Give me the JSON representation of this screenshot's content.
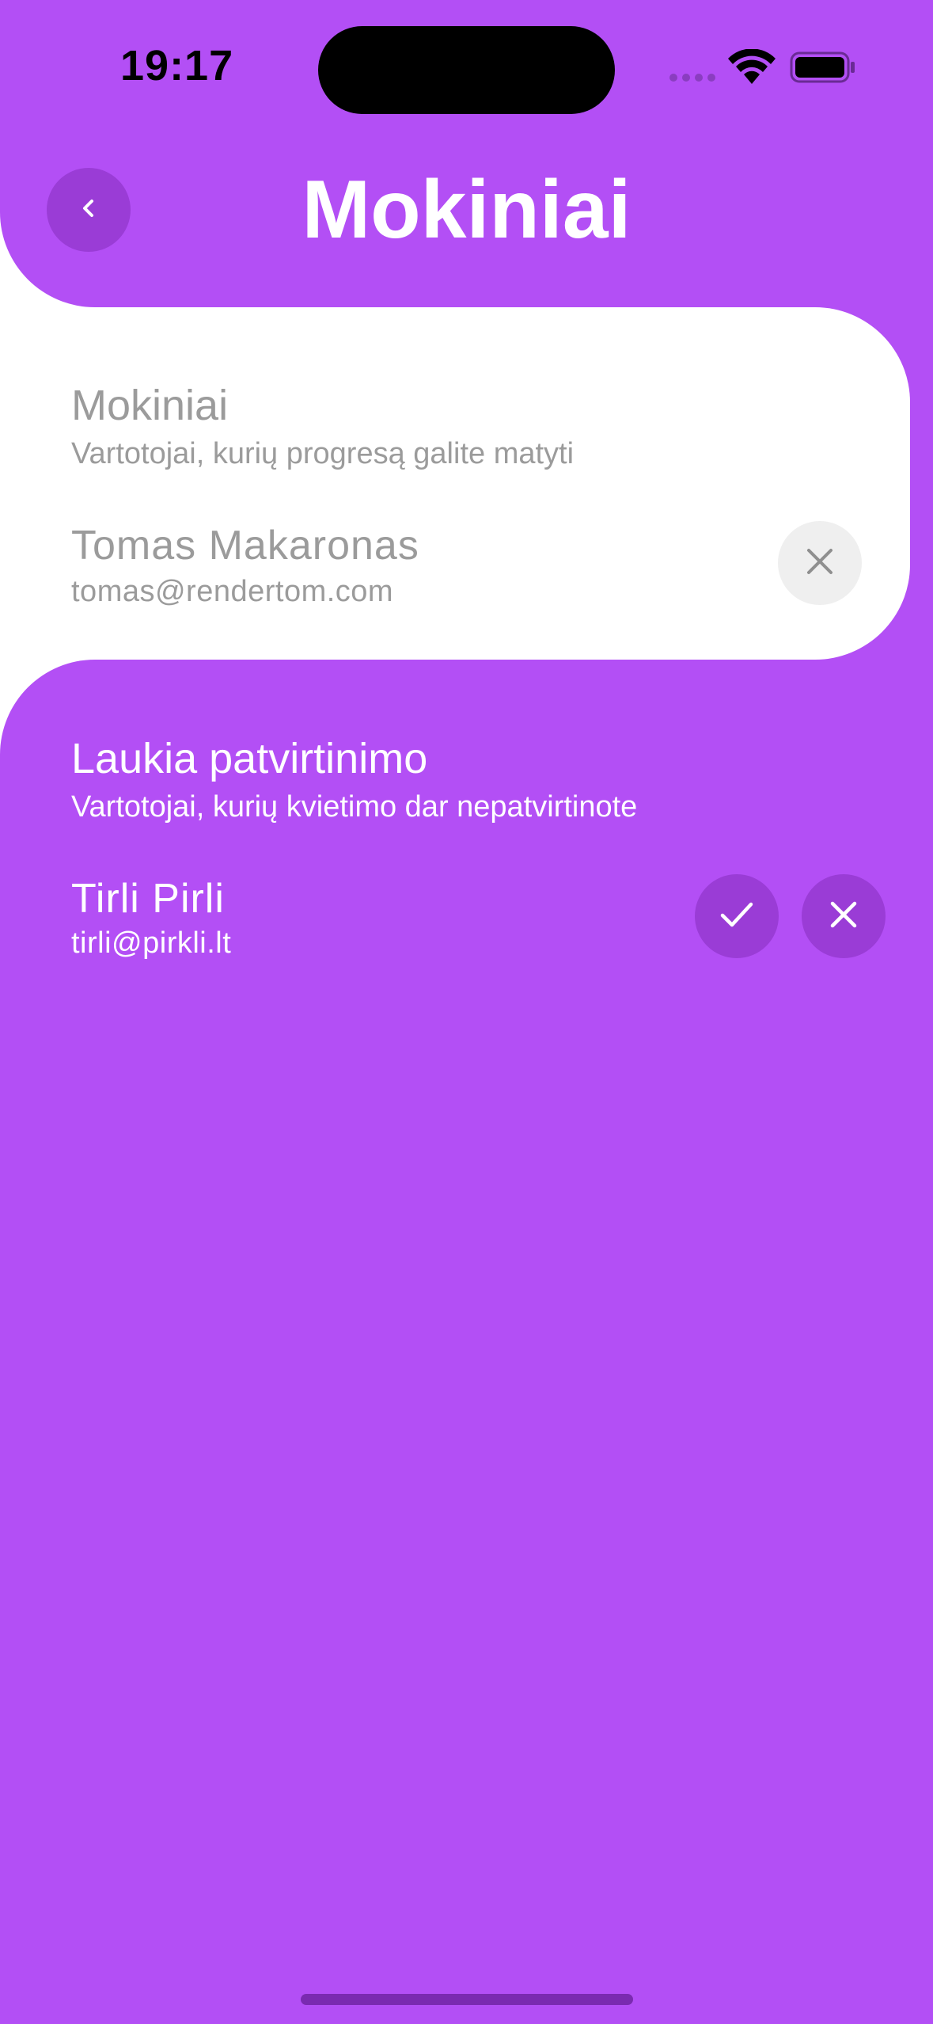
{
  "status_bar": {
    "time": "19:17"
  },
  "header": {
    "title": "Mokiniai",
    "back_icon": "chevron-left-icon"
  },
  "students_section": {
    "title": "Mokiniai",
    "subtitle": "Vartotojai, kurių progresą galite matyti",
    "users": [
      {
        "name": "Tomas Makaronas",
        "email": "tomas@rendertom.com"
      }
    ]
  },
  "pending_section": {
    "title": "Laukia patvirtinimo",
    "subtitle": "Vartotojai, kurių kvietimo dar nepatvirtinote",
    "users": [
      {
        "name": "Tirli Pirli",
        "email": "tirli@pirkli.lt"
      }
    ]
  },
  "colors": {
    "primary": "#b34ff5",
    "button_dark": "#9a3cd6",
    "button_light": "#efefef",
    "text_grey": "#9b9b9b"
  }
}
